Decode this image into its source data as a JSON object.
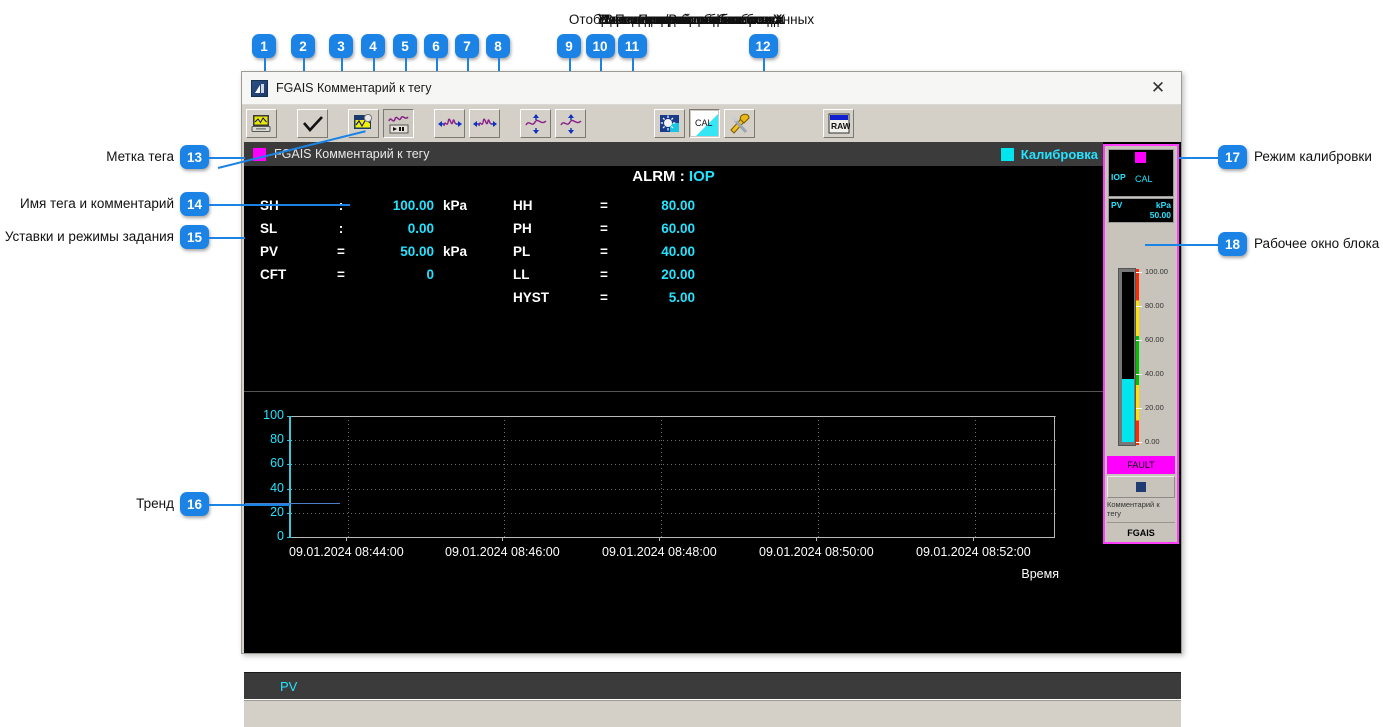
{
  "top_captions": [
    "Сделать копию экрана блока",
    "Подтвердить изменения",
    "Включить/Выключить тренд",
    "Уменьшить масштаб по оси Х",
    "Увеличить масштаб по оси Х",
    "Уменьшить масштаб по оси Y",
    "Увеличить масштаб по оси Y",
    "Яркость графика",
    "Переход в режим калибровки",
    "Настройка блока",
    "Отображение необработанных данных"
  ],
  "callouts": [
    {
      "n": "1"
    },
    {
      "n": "2"
    },
    {
      "n": "3"
    },
    {
      "n": "4"
    },
    {
      "n": "5"
    },
    {
      "n": "6"
    },
    {
      "n": "7"
    },
    {
      "n": "8"
    },
    {
      "n": "9"
    },
    {
      "n": "10"
    },
    {
      "n": "11"
    },
    {
      "n": "12"
    }
  ],
  "side_callouts": {
    "left": [
      {
        "n": "13",
        "label": "Метка тега"
      },
      {
        "n": "14",
        "label": "Имя тега и комментарий"
      },
      {
        "n": "15",
        "label": "Уставки и режимы задания"
      },
      {
        "n": "16",
        "label": "Тренд"
      }
    ],
    "right": [
      {
        "n": "17",
        "label": "Режим калибровки"
      },
      {
        "n": "18",
        "label": "Рабочее окно блока"
      }
    ]
  },
  "window": {
    "title": "FGAIS Комментарий к тегу",
    "close_label": "✕"
  },
  "toolbar": {
    "buttons": [
      {
        "name": "print-screen-icon",
        "tip": "Сделать копию экрана блока"
      },
      {
        "name": "confirm-check-icon",
        "tip": "Подтвердить изменения"
      },
      {
        "name": "trend-toggle-icon",
        "tip": "Включить/Выключить тренд"
      },
      {
        "name": "x-zoom-out-icon",
        "tip": "Уменьшить масштаб по оси X"
      },
      {
        "name": "x-zoom-in-icon",
        "tip": "Увеличить масштаб по оси X"
      },
      {
        "name": "y-zoom-in-icon",
        "tip": "Увеличить масштаб по оси Y"
      },
      {
        "name": "y-zoom-out-icon",
        "tip": "Уменьшить масштаб по оси Y"
      },
      {
        "name": "brightness-icon",
        "tip": "Яркость графика"
      },
      {
        "name": "cal-mode-icon",
        "label": "CAL",
        "tip": "Переход в режим калибровки"
      },
      {
        "name": "settings-tools-icon",
        "tip": "Настройка блока"
      },
      {
        "name": "raw-data-icon",
        "label": "RAW",
        "tip": "Отображение необработанных данных"
      }
    ]
  },
  "tag": {
    "label": "FGAIS Комментарий к тегу",
    "calibration_label": "Калибровка",
    "swatch_color": "#ff00ff",
    "calibration_color": "#00e5ee"
  },
  "alarm": {
    "name": "ALRM",
    "separator": ":",
    "value": "IOP"
  },
  "params_left": [
    {
      "label": "SH",
      "op": ":",
      "value": "100.00",
      "unit": "kPa"
    },
    {
      "label": "SL",
      "op": ":",
      "value": "0.00",
      "unit": ""
    },
    {
      "label": "PV",
      "op": "=",
      "value": "50.00",
      "unit": "kPa"
    },
    {
      "label": "CFT",
      "op": "=",
      "value": "0",
      "unit": ""
    }
  ],
  "params_right": [
    {
      "label": "HH",
      "op": "=",
      "value": "80.00"
    },
    {
      "label": "PH",
      "op": "=",
      "value": "60.00"
    },
    {
      "label": "PL",
      "op": "=",
      "value": "40.00"
    },
    {
      "label": "LL",
      "op": "=",
      "value": "20.00"
    },
    {
      "label": "HYST",
      "op": "=",
      "value": "5.00"
    }
  ],
  "chart_data": {
    "type": "line",
    "title": "",
    "xlabel": "Время",
    "ylabel": "",
    "ylim": [
      0,
      100
    ],
    "yticks": [
      "0",
      "20",
      "40",
      "60",
      "80",
      "100"
    ],
    "xticks": [
      "09.01.2024 08:44:00",
      "09.01.2024 08:46:00",
      "09.01.2024 08:48:00",
      "09.01.2024 08:50:00",
      "09.01.2024 08:52:00"
    ],
    "grid": true,
    "legend_position": "bottom",
    "series": [
      {
        "name": "PV",
        "color": "#25e3ff",
        "values": []
      }
    ]
  },
  "legend": {
    "pv_label": "PV"
  },
  "faceplate": {
    "mode_left": "IOP",
    "mode_right": "CAL",
    "pv_label": "PV",
    "unit": "kPa",
    "pv_value": "50.00",
    "scale": [
      "100.00",
      "80.00",
      "60.00",
      "40.00",
      "20.00",
      "0.00"
    ],
    "status": "FAULT",
    "comment": "Комментарий к тегу",
    "tag_name": "FGAIS"
  }
}
